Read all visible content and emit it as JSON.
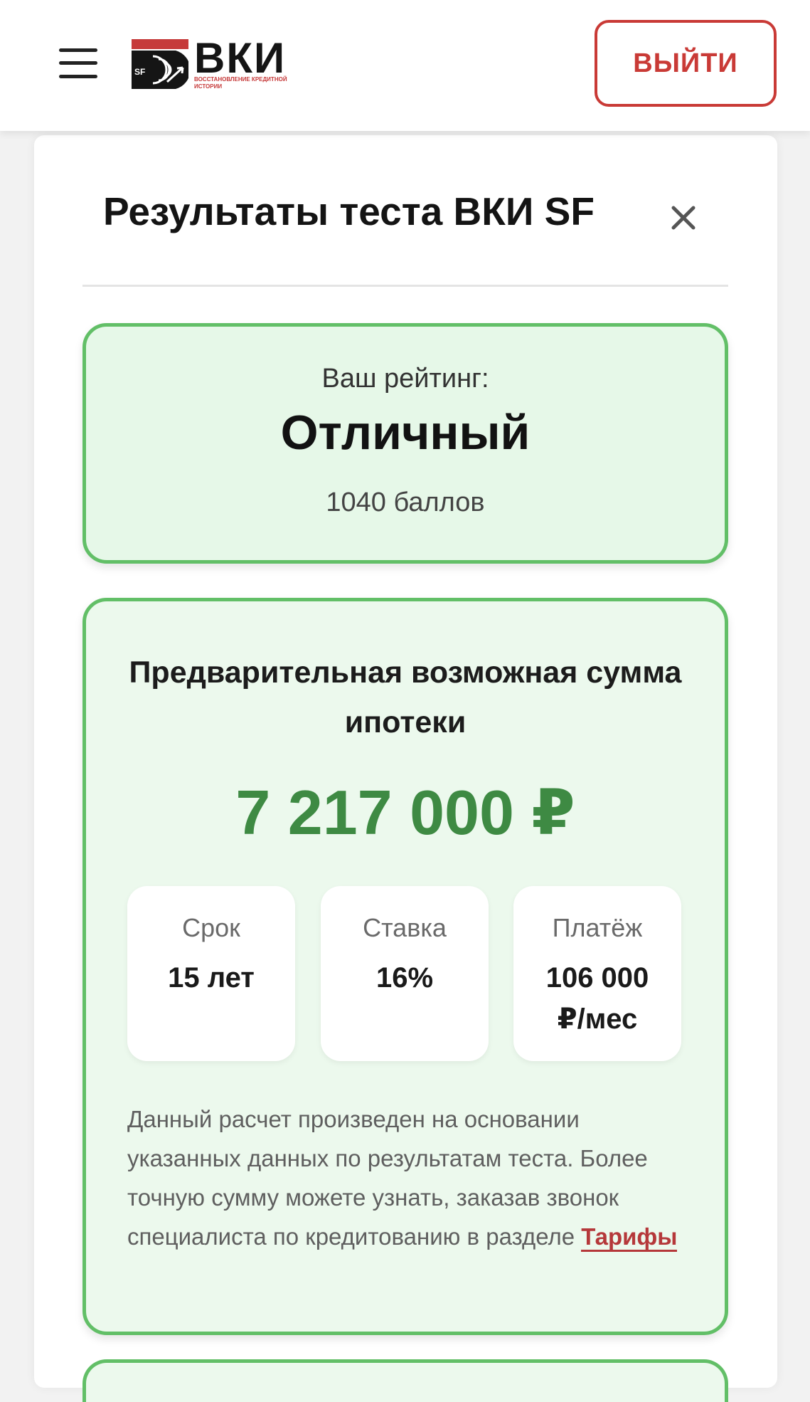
{
  "header": {
    "logo_text": "ВКИ",
    "logo_badge": "SF",
    "logo_subtitle": "ВОССТАНОВЛЕНИЕ КРЕДИТНОЙ ИСТОРИИ",
    "logout_label": "ВЫЙТИ"
  },
  "panel": {
    "title": "Результаты теста ВКИ SF"
  },
  "rating": {
    "label": "Ваш рейтинг:",
    "value": "Отличный",
    "points": "1040 баллов"
  },
  "mortgage": {
    "title": "Предварительная возможная сумма ипотеки",
    "amount": "7 217 000 ₽",
    "stats": [
      {
        "label": "Срок",
        "value": "15 лет"
      },
      {
        "label": "Ставка",
        "value": "16%"
      },
      {
        "label": "Платёж",
        "value": "106 000 ₽/мес"
      }
    ],
    "disclaimer": "Данный расчет произведен на основании указанных данных по результатам теста. Более точную сумму можете узнать, заказав звонок специалиста по кредитованию в разделе ",
    "link_label": "Тарифы"
  },
  "colors": {
    "accent_red": "#c93a36",
    "green_border": "#62bf67",
    "green_text": "#3e8a43"
  }
}
